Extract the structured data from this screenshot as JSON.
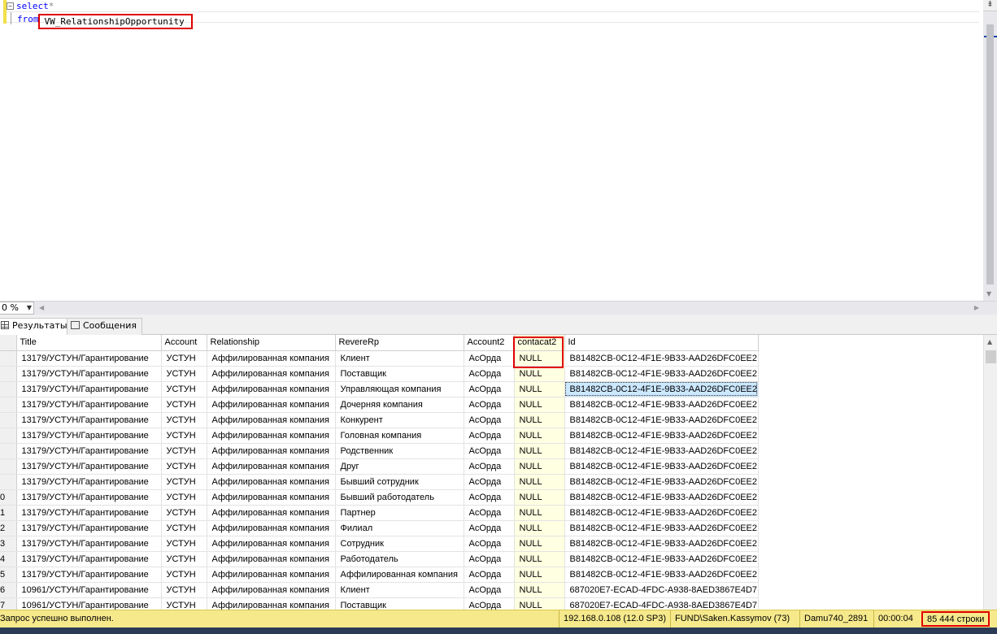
{
  "editor": {
    "line1_keyword": "select",
    "line1_tail": "*",
    "line2_keyword": "from",
    "line2_table": "VW_RelationshipOpportunity"
  },
  "zoom": {
    "value": "0 %"
  },
  "tabs": {
    "results_label": "Результаты",
    "messages_label": "Сообщения"
  },
  "grid": {
    "columns": [
      "Title",
      "Account",
      "Relationship",
      "RevereRp",
      "Account2",
      "contacat2",
      "Id"
    ],
    "rows": [
      {
        "n": "",
        "title": "13179/УСТУН/Гарантирование",
        "account": "УСТУН",
        "relationship": "Аффилированная компания",
        "reverse": "Клиент",
        "account2": "АсОрда",
        "contact": "NULL",
        "id": "B81482CB-0C12-4F1E-9B33-AAD26DFC0EE2"
      },
      {
        "n": "",
        "title": "13179/УСТУН/Гарантирование",
        "account": "УСТУН",
        "relationship": "Аффилированная компания",
        "reverse": "Поставщик",
        "account2": "АсОрда",
        "contact": "NULL",
        "id": "B81482CB-0C12-4F1E-9B33-AAD26DFC0EE2"
      },
      {
        "n": "",
        "title": "13179/УСТУН/Гарантирование",
        "account": "УСТУН",
        "relationship": "Аффилированная компания",
        "reverse": "Управляющая компания",
        "account2": "АсОрда",
        "contact": "NULL",
        "id": "B81482CB-0C12-4F1E-9B33-AAD26DFC0EE2"
      },
      {
        "n": "",
        "title": "13179/УСТУН/Гарантирование",
        "account": "УСТУН",
        "relationship": "Аффилированная компания",
        "reverse": "Дочерняя компания",
        "account2": "АсОрда",
        "contact": "NULL",
        "id": "B81482CB-0C12-4F1E-9B33-AAD26DFC0EE2"
      },
      {
        "n": "",
        "title": "13179/УСТУН/Гарантирование",
        "account": "УСТУН",
        "relationship": "Аффилированная компания",
        "reverse": "Конкурент",
        "account2": "АсОрда",
        "contact": "NULL",
        "id": "B81482CB-0C12-4F1E-9B33-AAD26DFC0EE2"
      },
      {
        "n": "",
        "title": "13179/УСТУН/Гарантирование",
        "account": "УСТУН",
        "relationship": "Аффилированная компания",
        "reverse": "Головная компания",
        "account2": "АсОрда",
        "contact": "NULL",
        "id": "B81482CB-0C12-4F1E-9B33-AAD26DFC0EE2"
      },
      {
        "n": "",
        "title": "13179/УСТУН/Гарантирование",
        "account": "УСТУН",
        "relationship": "Аффилированная компания",
        "reverse": "Родственник",
        "account2": "АсОрда",
        "contact": "NULL",
        "id": "B81482CB-0C12-4F1E-9B33-AAD26DFC0EE2"
      },
      {
        "n": "",
        "title": "13179/УСТУН/Гарантирование",
        "account": "УСТУН",
        "relationship": "Аффилированная компания",
        "reverse": "Друг",
        "account2": "АсОрда",
        "contact": "NULL",
        "id": "B81482CB-0C12-4F1E-9B33-AAD26DFC0EE2"
      },
      {
        "n": "",
        "title": "13179/УСТУН/Гарантирование",
        "account": "УСТУН",
        "relationship": "Аффилированная компания",
        "reverse": "Бывший сотрудник",
        "account2": "АсОрда",
        "contact": "NULL",
        "id": "B81482CB-0C12-4F1E-9B33-AAD26DFC0EE2"
      },
      {
        "n": "0",
        "title": "13179/УСТУН/Гарантирование",
        "account": "УСТУН",
        "relationship": "Аффилированная компания",
        "reverse": "Бывший работодатель",
        "account2": "АсОрда",
        "contact": "NULL",
        "id": "B81482CB-0C12-4F1E-9B33-AAD26DFC0EE2"
      },
      {
        "n": "1",
        "title": "13179/УСТУН/Гарантирование",
        "account": "УСТУН",
        "relationship": "Аффилированная компания",
        "reverse": "Партнер",
        "account2": "АсОрда",
        "contact": "NULL",
        "id": "B81482CB-0C12-4F1E-9B33-AAD26DFC0EE2"
      },
      {
        "n": "2",
        "title": "13179/УСТУН/Гарантирование",
        "account": "УСТУН",
        "relationship": "Аффилированная компания",
        "reverse": "Филиал",
        "account2": "АсОрда",
        "contact": "NULL",
        "id": "B81482CB-0C12-4F1E-9B33-AAD26DFC0EE2"
      },
      {
        "n": "3",
        "title": "13179/УСТУН/Гарантирование",
        "account": "УСТУН",
        "relationship": "Аффилированная компания",
        "reverse": "Сотрудник",
        "account2": "АсОрда",
        "contact": "NULL",
        "id": "B81482CB-0C12-4F1E-9B33-AAD26DFC0EE2"
      },
      {
        "n": "4",
        "title": "13179/УСТУН/Гарантирование",
        "account": "УСТУН",
        "relationship": "Аффилированная компания",
        "reverse": "Работодатель",
        "account2": "АсОрда",
        "contact": "NULL",
        "id": "B81482CB-0C12-4F1E-9B33-AAD26DFC0EE2"
      },
      {
        "n": "5",
        "title": "13179/УСТУН/Гарантирование",
        "account": "УСТУН",
        "relationship": "Аффилированная компания",
        "reverse": "Аффилированная компания",
        "account2": "АсОрда",
        "contact": "NULL",
        "id": "B81482CB-0C12-4F1E-9B33-AAD26DFC0EE2"
      },
      {
        "n": "6",
        "title": "10961/УСТУН/Гарантирование",
        "account": "УСТУН",
        "relationship": "Аффилированная компания",
        "reverse": "Клиент",
        "account2": "АсОрда",
        "contact": "NULL",
        "id": "687020E7-ECAD-4FDC-A938-8AED3867E4D7"
      },
      {
        "n": "7",
        "title": "10961/УСТУН/Гарантирование",
        "account": "УСТУН",
        "relationship": "Аффилированная компания",
        "reverse": "Поставщик",
        "account2": "АсОрда",
        "contact": "NULL",
        "id": "687020E7-ECAD-4FDC-A938-8AED3867E4D7"
      }
    ]
  },
  "status": {
    "message": "Запрос успешно выполнен.",
    "server": "192.168.0.108 (12.0 SP3)",
    "user": "FUND\\Saken.Kassymov (73)",
    "database": "Damu740_2891",
    "elapsed": "00:00:04",
    "rows": "85 444 строки"
  }
}
